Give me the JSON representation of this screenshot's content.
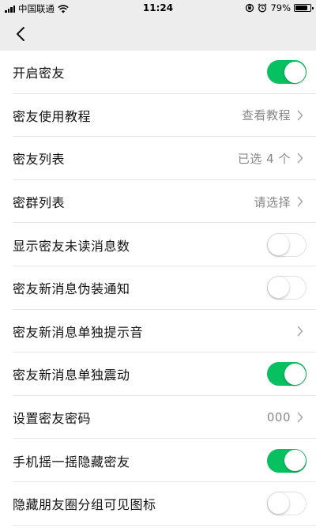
{
  "status_bar": {
    "carrier": "中国联通",
    "time": "11:24",
    "battery_percent": "79%",
    "battery_level": 0.79,
    "icons": [
      "signal-icon",
      "wifi-icon",
      "orientation-lock-icon",
      "alarm-icon",
      "battery-icon"
    ]
  },
  "nav": {
    "back_icon": "chevron-left-icon"
  },
  "settings": [
    {
      "label": "开启密友",
      "type": "toggle",
      "on": true
    },
    {
      "label": "密友使用教程",
      "type": "link",
      "value": "查看教程"
    },
    {
      "label": "密友列表",
      "type": "link",
      "value": "已选 4 个"
    },
    {
      "label": "密群列表",
      "type": "link",
      "value": "请选择"
    },
    {
      "label": "显示密友未读消息数",
      "type": "toggle",
      "on": false
    },
    {
      "label": "密友新消息伪装通知",
      "type": "toggle",
      "on": false
    },
    {
      "label": "密友新消息单独提示音",
      "type": "link",
      "value": ""
    },
    {
      "label": "密友新消息单独震动",
      "type": "toggle",
      "on": true
    },
    {
      "label": "设置密友密码",
      "type": "link",
      "value": "000"
    },
    {
      "label": "手机摇一摇隐藏密友",
      "type": "toggle",
      "on": true
    },
    {
      "label": "隐藏朋友圈分组可见图标",
      "type": "toggle",
      "on": false
    }
  ],
  "colors": {
    "accent": "#07c160",
    "header_bg": "#ededed",
    "value_text": "#888888"
  }
}
